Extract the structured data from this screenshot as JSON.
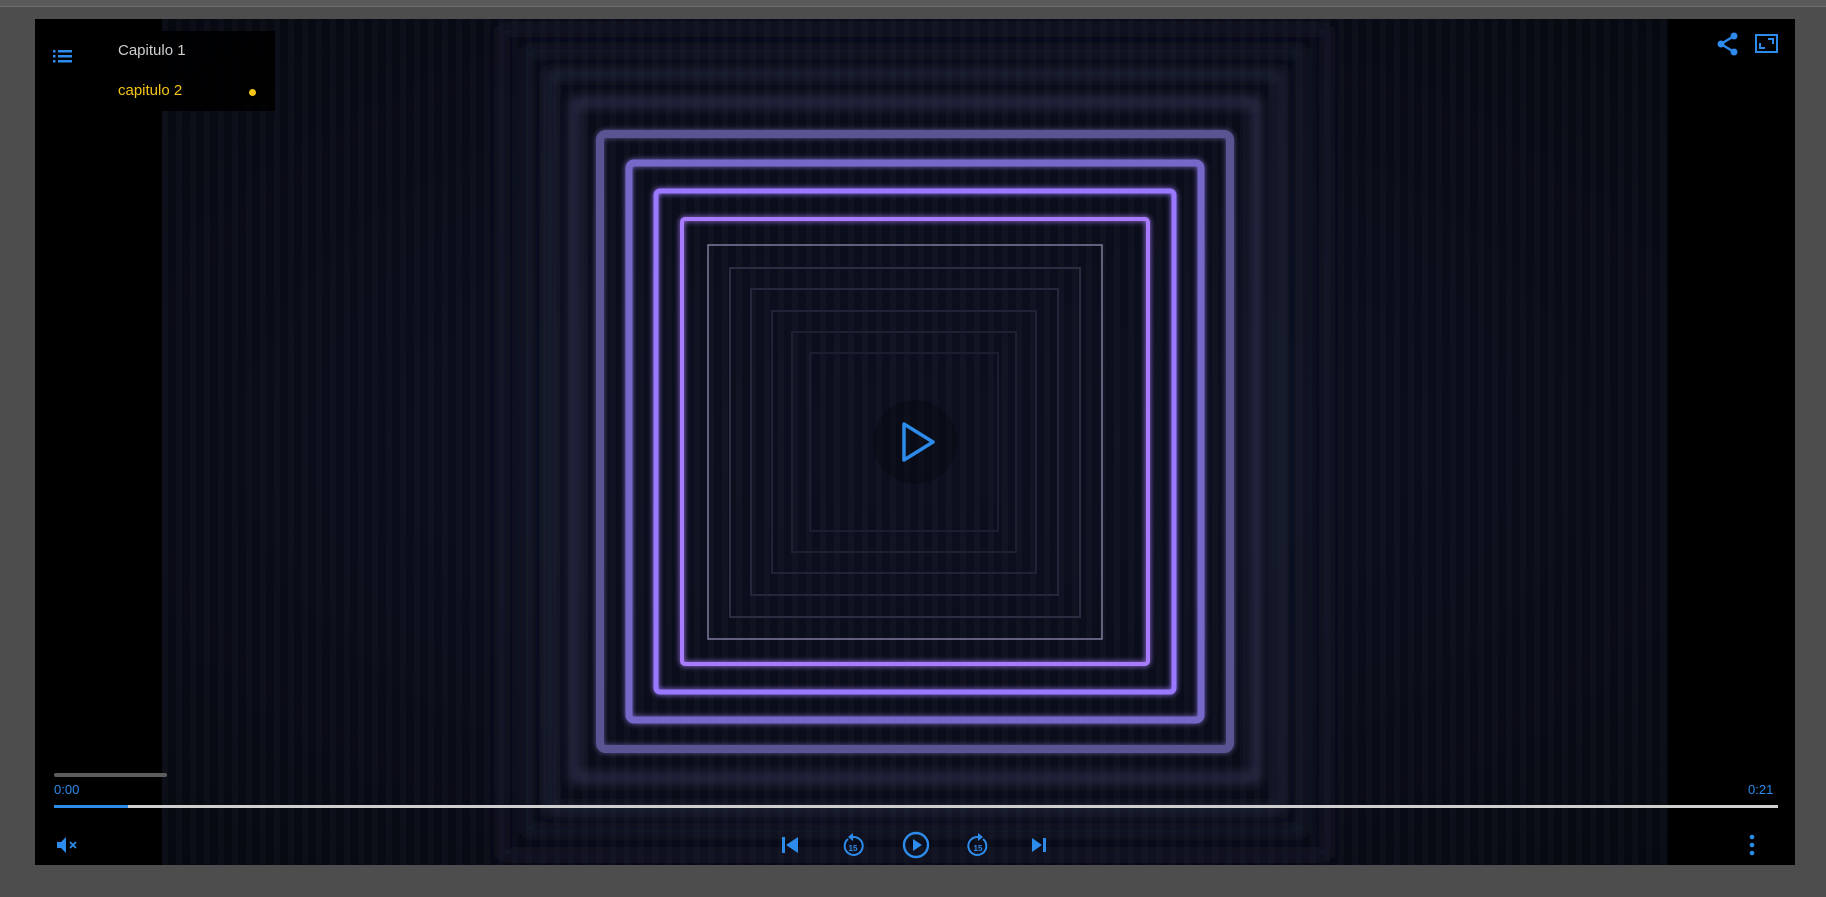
{
  "chapters": {
    "items": [
      {
        "label": "Capitulo 1",
        "active": false
      },
      {
        "label": "capitulo 2",
        "active": true
      }
    ],
    "active_color": "#f5c518"
  },
  "playback": {
    "current_time": "0:00",
    "duration": "0:21",
    "progress_fraction": 0.043,
    "muted": true
  },
  "icons": {
    "menu": "list-icon",
    "share": "share-icon",
    "fullscreen": "fullscreen-icon",
    "big_play": "play-icon",
    "mute": "volume-muted-icon",
    "prev": "skip-previous-icon",
    "rewind": "replay-15-icon",
    "play": "play-circle-icon",
    "forward": "forward-15-icon",
    "next": "skip-next-icon",
    "more": "more-vertical-icon"
  },
  "colors": {
    "accent": "#2d8ceb",
    "background": "#4d4d4d",
    "player": "#000000"
  }
}
